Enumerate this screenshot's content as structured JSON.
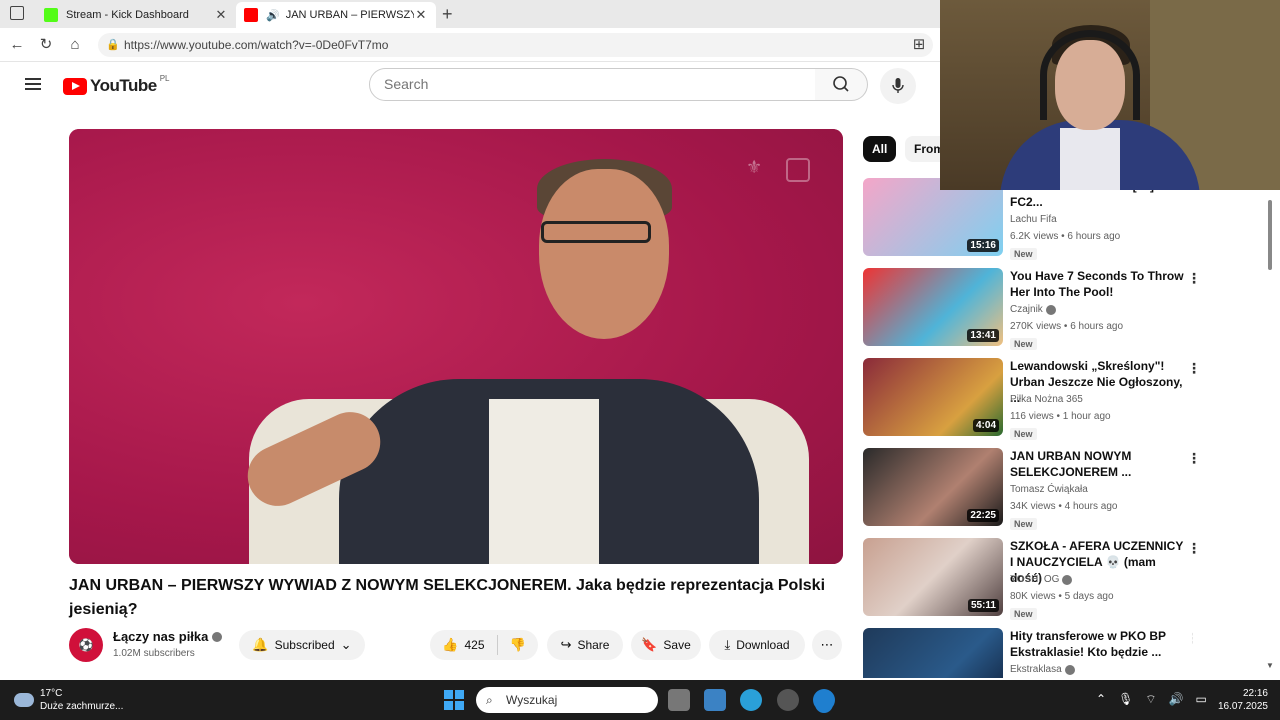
{
  "browser": {
    "tabs": [
      {
        "title": "Stream - Kick Dashboard",
        "favicon_color": "#53fc18"
      },
      {
        "title": "JAN URBAN – PIERWSZY WY",
        "favicon_color": "#ff0000"
      }
    ],
    "url": "https://www.youtube.com/watch?v=-0De0FvT7mo"
  },
  "youtube": {
    "logo_text": "YouTube",
    "country_code": "PL",
    "search_placeholder": "Search"
  },
  "video": {
    "title": "JAN URBAN – PIERWSZY WYWIAD Z NOWYM SELEKCJONEREM. Jaka będzie reprezentacja Polski jesienią?",
    "channel": {
      "name": "Łączy nas piłka",
      "subscribers": "1.02M subscribers"
    },
    "actions": {
      "subscribed": "Subscribed",
      "likes": "425",
      "share": "Share",
      "save": "Save",
      "download": "Download"
    }
  },
  "chips": [
    "All",
    "From"
  ],
  "recommendations": [
    {
      "title": "FUTTIES TRAFIONA! [#2] FC2...",
      "channel": "Lachu Fifa",
      "meta": "6.2K views • 6 hours ago",
      "badge": "New",
      "duration": "15:16",
      "verified": false,
      "thumb_color": "#f4a6c8"
    },
    {
      "title": "You Have 7 Seconds To Throw Her Into The Pool!",
      "channel": "Czajnik",
      "meta": "270K views • 6 hours ago",
      "badge": "New",
      "duration": "13:41",
      "verified": true,
      "thumb_color": "#4fb4d8"
    },
    {
      "title": "Lewandowski „Skreślony\"! Urban Jeszcze Nie Ogłoszony, ...",
      "channel": "Piłka Nożna 365",
      "meta": "116 views • 1 hour ago",
      "badge": "New",
      "duration": "4:04",
      "verified": false,
      "thumb_color": "#8a2a3a"
    },
    {
      "title": "JAN URBAN NOWYM SELEKCJONEREM ...",
      "channel": "Tomasz Ćwiąkała",
      "meta": "34K views • 4 hours ago",
      "badge": "New",
      "duration": "22:25",
      "verified": false,
      "thumb_color": "#2a2a2a"
    },
    {
      "title": "SZKOŁA - AFERA UCZENNICY I NAUCZYCIELA 💀 (mam dość)",
      "channel": "YOSHI OG",
      "meta": "80K views • 5 days ago",
      "badge": "New",
      "duration": "55:11",
      "verified": true,
      "thumb_color": "#c8a090"
    },
    {
      "title": "Hity transferowe w PKO BP Ekstraklasie! Kto będzie ...",
      "channel": "Ekstraklasa",
      "meta": "",
      "badge": "",
      "duration": "",
      "verified": true,
      "thumb_color": "#1f3a5a"
    }
  ],
  "taskbar": {
    "weather_temp": "17°C",
    "weather_desc": "Duże zachmurze...",
    "search_placeholder": "Wyszukaj",
    "time": "22:16",
    "date": "16.07.2025"
  }
}
